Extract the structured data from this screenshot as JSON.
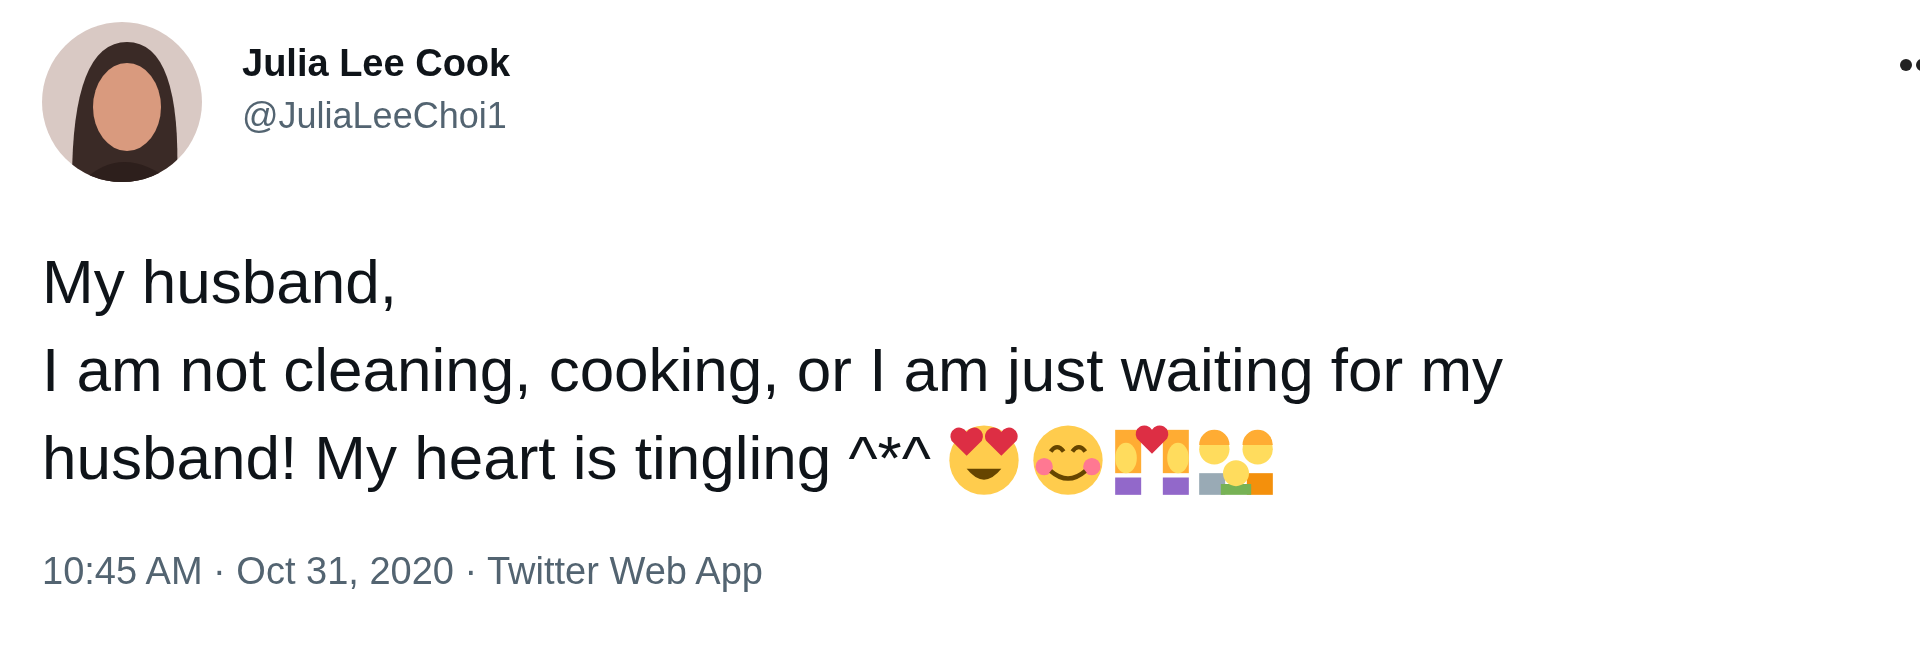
{
  "author": {
    "name": "Julia Lee Cook",
    "handle": "@JuliaLeeChoi1"
  },
  "tweet": {
    "lines": [
      "My husband,",
      "I am not cleaning, cooking, or I am just waiting for my",
      "husband! My heart is tingling ^*^"
    ],
    "emojis": [
      {
        "kind": "heart-eyes"
      },
      {
        "kind": "smile"
      },
      {
        "kind": "couple"
      },
      {
        "kind": "family"
      }
    ]
  },
  "meta": "10:45 AM · Oct 31, 2020 · Twitter Web App"
}
